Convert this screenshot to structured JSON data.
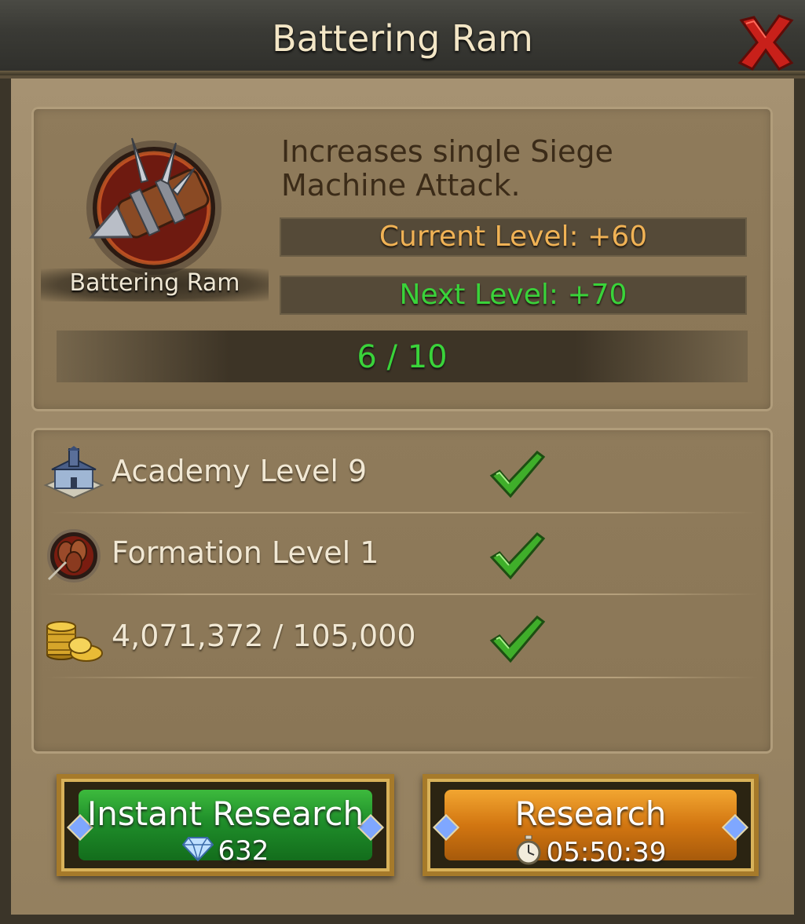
{
  "window": {
    "title": "Battering Ram"
  },
  "research_item": {
    "name": "Battering Ram",
    "icon": "battering-ram-icon",
    "description": "Increases single Siege Machine Attack.",
    "current_level_label": "Current Level: +60",
    "next_level_label": "Next Level: +70",
    "progress_text": "6 / 10",
    "progress": {
      "current": 6,
      "max": 10
    }
  },
  "requirements": [
    {
      "icon": "academy-building-icon",
      "text": "Academy Level 9",
      "met": true
    },
    {
      "icon": "formation-icon",
      "text": "Formation Level 1",
      "met": true
    },
    {
      "icon": "gold-coins-icon",
      "text": "4,071,372 / 105,000",
      "met": true
    }
  ],
  "buttons": {
    "instant": {
      "label": "Instant Research",
      "cost": "632",
      "cost_icon": "diamond-icon"
    },
    "research": {
      "label": "Research",
      "time": "05:50:39",
      "time_icon": "stopwatch-icon"
    }
  },
  "colors": {
    "current_level": "#f0b255",
    "next_level": "#3ad33a",
    "progress_text": "#3ad33a",
    "instant_button": "#1f8e2a",
    "research_button": "#d27611",
    "close_x": "#c8201a"
  }
}
